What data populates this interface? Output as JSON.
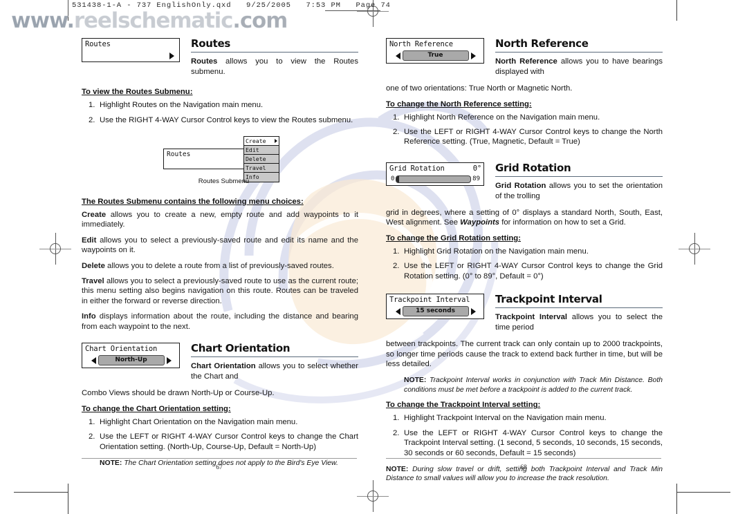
{
  "scan": {
    "slug": "531438-1-A - 737 EnglishOnly.qxd   9/25/2005   7:53 PM   Page 74",
    "watermark_part1": "www.",
    "watermark_part2": "reelschematic",
    "watermark_part3": ".com"
  },
  "left_page": {
    "page_number": "67",
    "sections": [
      {
        "id": "routes",
        "widget": {
          "type": "submenu-entry",
          "title": "Routes",
          "has_right_arrow": true
        },
        "title": "Routes",
        "lead_bold": "Routes",
        "lead_rest": " allows you to view the Routes submenu.",
        "procedure_heading": "To view the Routes Submenu:",
        "steps": [
          "Highlight Routes on the Navigation main menu.",
          "Use the RIGHT 4-WAY Cursor Control keys to view the Routes submenu."
        ],
        "diagram": {
          "box_label": "Routes",
          "menu_items": [
            "Create",
            "Edit",
            "Delete",
            "Travel",
            "Info"
          ],
          "selected_item": "Create",
          "caption": "Routes Submenu"
        },
        "defs_heading": "The Routes Submenu contains the following menu choices:",
        "definitions": [
          {
            "term": "Create",
            "text": " allows you to create a new, empty route and add waypoints to it immediately."
          },
          {
            "term": "Edit",
            "text": " allows you to select a previously-saved route and edit its name and the waypoints on it."
          },
          {
            "term": "Delete",
            "text": " allows you to delete a route from a list of previously-saved routes."
          },
          {
            "term": "Travel",
            "text": " allows you to select a previously-saved route to use as the current route; this menu setting also begins navigation on this route. Routes can be traveled in either the forward or reverse direction."
          },
          {
            "term": "Info",
            "text": " displays information about the route, including the distance and bearing from each waypoint to the next."
          }
        ]
      },
      {
        "id": "chart-orientation",
        "widget": {
          "type": "value-selector",
          "title": "Chart Orientation",
          "value": "North-Up"
        },
        "title": "Chart Orientation",
        "lead_bold": "Chart Orientation",
        "lead_rest": " allows you to select whether the Chart and",
        "lead_wrap": "Combo Views should be drawn North-Up or Course-Up.",
        "procedure_heading": "To change the Chart Orientation setting:",
        "steps": [
          "Highlight Chart Orientation on the Navigation main menu.",
          "Use the LEFT or RIGHT 4-WAY Cursor Control keys to change the Chart Orientation setting. (North-Up, Course-Up, Default = North-Up)"
        ],
        "note_label": "NOTE:",
        "note_text": " The Chart Orientation setting does not apply to the Bird's Eye View."
      }
    ]
  },
  "right_page": {
    "page_number": "68",
    "sections": [
      {
        "id": "north-reference",
        "widget": {
          "type": "value-selector",
          "title": "North Reference",
          "value": "True"
        },
        "title": "North Reference",
        "lead_bold": "North Reference",
        "lead_rest": " allows you to have bearings displayed with",
        "lead_wrap": "one of two orientations: True North or Magnetic North.",
        "procedure_heading": "To change the North Reference setting:",
        "steps": [
          "Highlight North Reference on the Navigation main menu.",
          "Use the LEFT or RIGHT 4-WAY Cursor Control keys to change the North Reference setting. (True, Magnetic, Default = True)"
        ]
      },
      {
        "id": "grid-rotation",
        "widget": {
          "type": "slider",
          "title": "Grid Rotation",
          "value": "0°",
          "min": "0",
          "max": "89",
          "fill_percent": 0
        },
        "title": "Grid Rotation",
        "lead_bold": "Grid Rotation",
        "lead_rest": " allows you to set the orientation of the trolling",
        "lead_wrap_a": "grid in degrees, where a setting of 0° displays a standard North, South, East, West alignment. See ",
        "lead_wrap_italic": "Waypoints",
        "lead_wrap_b": " for information on how to set a Grid.",
        "procedure_heading": "To change the Grid Rotation setting:",
        "steps": [
          "Highlight Grid Rotation on the Navigation main menu.",
          "Use the LEFT or RIGHT 4-WAY Cursor Control keys to change the Grid Rotation setting. (0° to 89°, Default = 0°)"
        ]
      },
      {
        "id": "trackpoint-interval",
        "widget": {
          "type": "value-selector",
          "title": "Trackpoint Interval",
          "value": "15 seconds"
        },
        "title": "Trackpoint Interval",
        "lead_bold": "Trackpoint Interval",
        "lead_rest": " allows you to select the time period",
        "lead_wrap": "between trackpoints.  The current track can only contain up to 2000 trackpoints, so longer time periods cause the track to extend back further in time, but will be less detailed.",
        "note1_label": "NOTE:",
        "note1_text": " Trackpoint Interval works in conjunction with Track Min Distance.  Both conditions must be met before a trackpoint is added to the current track.",
        "procedure_heading": "To change the Trackpoint Interval setting:",
        "steps": [
          "Highlight Trackpoint Interval on the Navigation main menu.",
          "Use the LEFT or RIGHT 4-WAY Cursor Control keys to change the Trackpoint Interval setting. (1 second, 5 seconds, 10 seconds, 15 seconds, 30 seconds or 60 seconds, Default = 15 seconds)"
        ],
        "note2_label": "NOTE:",
        "note2_text": " During slow travel or drift, setting both Trackpoint Interval and Track Min Distance to small values will allow you to increase the track resolution."
      }
    ]
  }
}
